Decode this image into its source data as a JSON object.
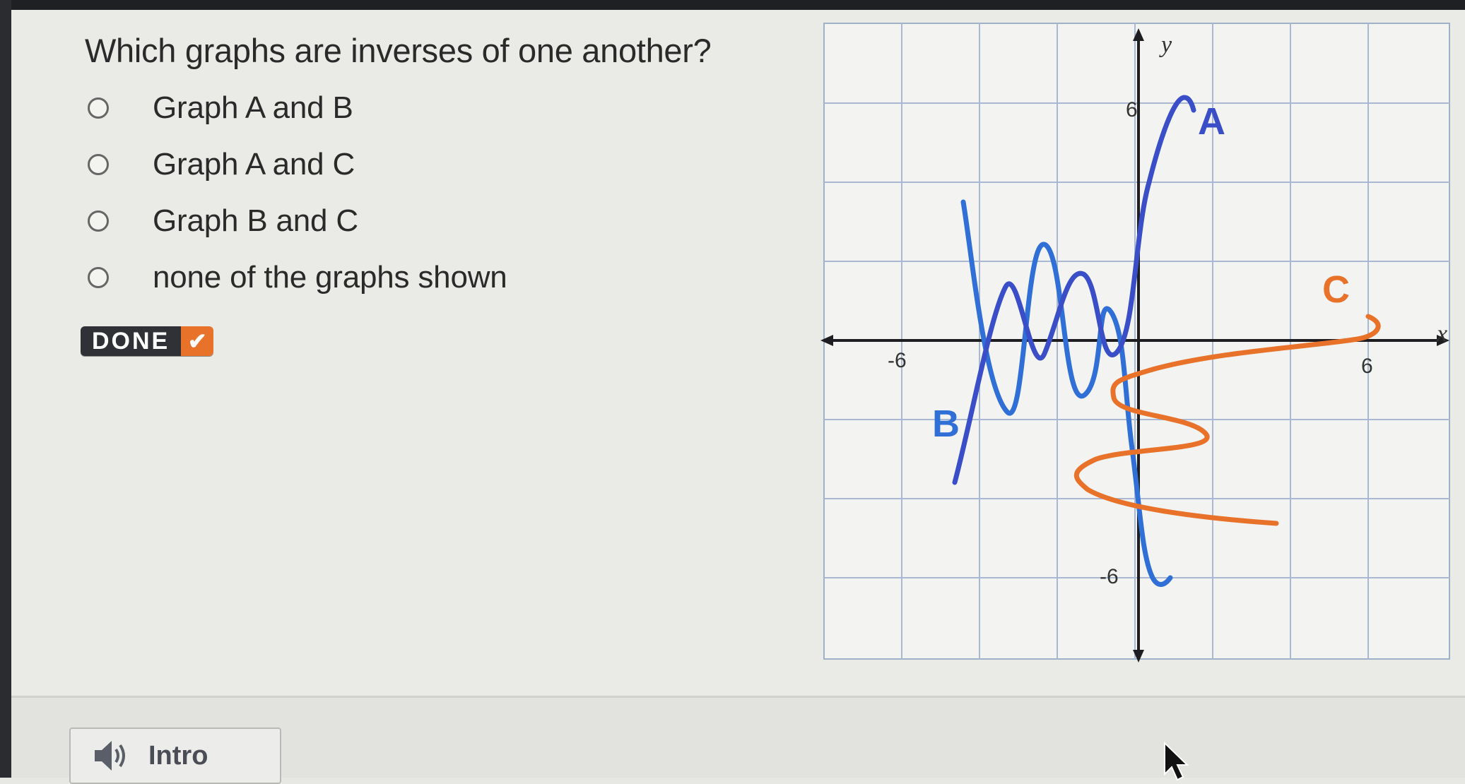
{
  "question": "Which graphs are inverses of one another?",
  "options": [
    {
      "label": "Graph A and B",
      "selected": false
    },
    {
      "label": "Graph A and C",
      "selected": false
    },
    {
      "label": "Graph B and C",
      "selected": false
    },
    {
      "label": "none of the graphs shown",
      "selected": false
    }
  ],
  "done_button": {
    "label": "DONE",
    "icon": "check-icon"
  },
  "graph": {
    "x_axis_label": "x",
    "y_axis_label": "y",
    "ticks": {
      "x_neg": "-6",
      "x_pos": "6",
      "y_pos": "6",
      "y_neg": "-6"
    },
    "curves": [
      {
        "label": "A",
        "color": "#3a4ec8"
      },
      {
        "label": "B",
        "color": "#2f6fd6"
      },
      {
        "label": "C",
        "color": "#e8722a"
      }
    ]
  },
  "footer": {
    "intro_label": "Intro",
    "intro_icon": "speaker-icon"
  }
}
